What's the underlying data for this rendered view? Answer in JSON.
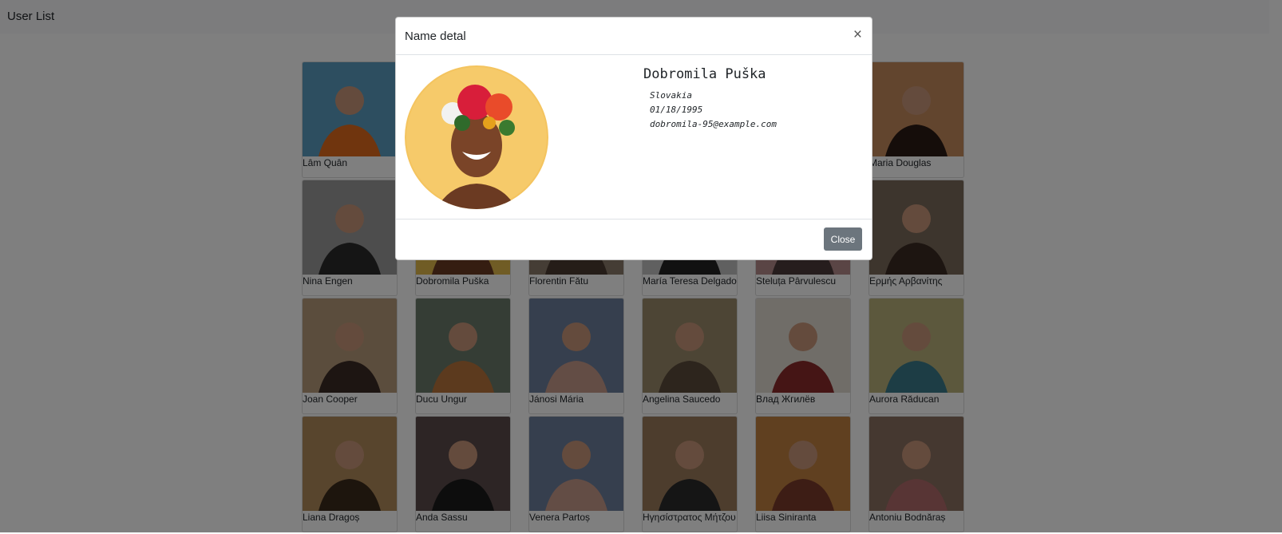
{
  "navbar": {
    "brand": "User List"
  },
  "users": [
    {
      "name": "Lâm Quân"
    },
    {
      "name": ""
    },
    {
      "name": ""
    },
    {
      "name": ""
    },
    {
      "name": ""
    },
    {
      "name": "Maria Douglas"
    },
    {
      "name": "Nina Engen"
    },
    {
      "name": "Dobromila Puška"
    },
    {
      "name": "Florentin Fătu"
    },
    {
      "name": "María Teresa Delgado"
    },
    {
      "name": "Steluța Pârvulescu"
    },
    {
      "name": "Ερμής Αρβανίτης"
    },
    {
      "name": "Joan Cooper"
    },
    {
      "name": "Ducu Ungur"
    },
    {
      "name": "Jánosi Mária"
    },
    {
      "name": "Angelina Saucedo"
    },
    {
      "name": "Влад Жгилёв"
    },
    {
      "name": "Aurora Răducan"
    },
    {
      "name": "Liana Dragoș"
    },
    {
      "name": "Anda Sassu"
    },
    {
      "name": "Venera Partoș"
    },
    {
      "name": "Ηγησίστρατος Μήτζου"
    },
    {
      "name": "Liisa Siniranta"
    },
    {
      "name": "Antoniu Bodnăraș"
    }
  ],
  "modal": {
    "title": "Name detal",
    "close_symbol": "×",
    "name": "Dobromila Puška",
    "country": "Slovakia",
    "dob": "01/18/1995",
    "email": "dobromila-95@example.com",
    "close_label": "Close"
  }
}
